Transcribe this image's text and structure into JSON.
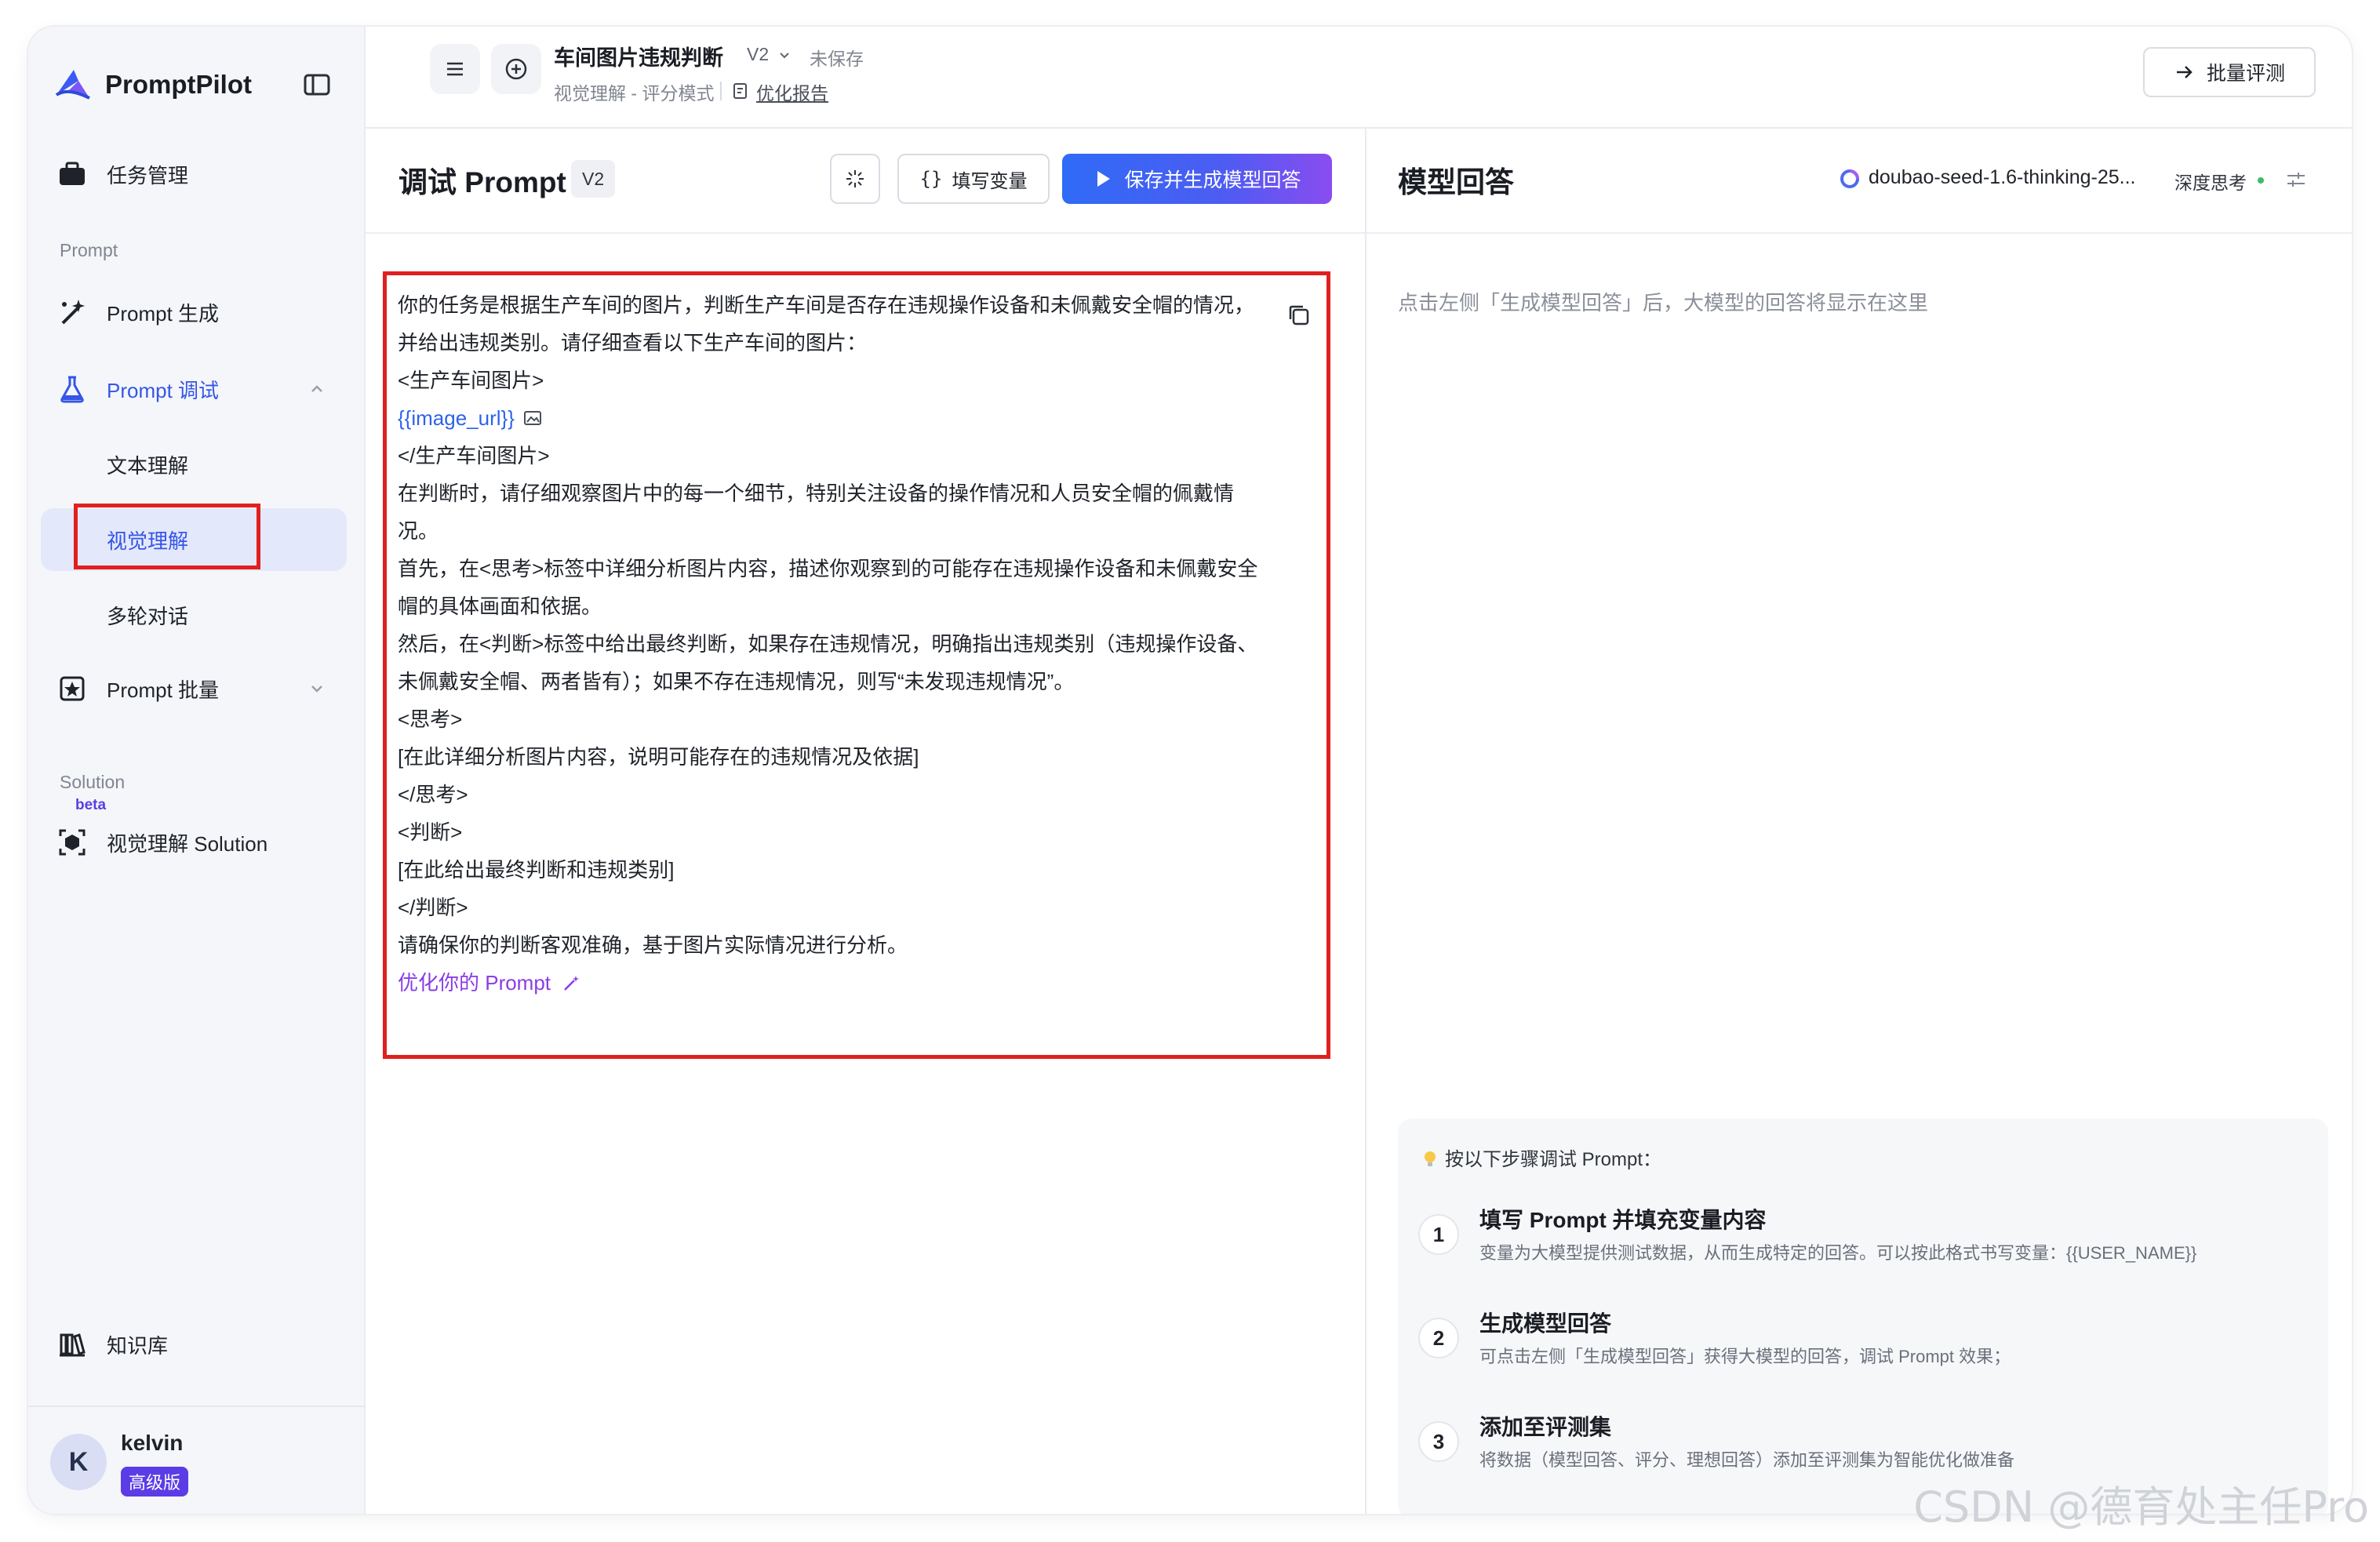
{
  "brand": {
    "name": "PromptPilot"
  },
  "sidebar": {
    "task_mgmt": "任务管理",
    "section_prompt": "Prompt",
    "prompt_gen": "Prompt 生成",
    "prompt_debug": "Prompt 调试",
    "sub_text": "文本理解",
    "sub_vision": "视觉理解",
    "sub_multi": "多轮对话",
    "prompt_batch": "Prompt 批量",
    "section_solution": "Solution",
    "beta": "beta",
    "vision_solution": "视觉理解 Solution",
    "knowledge": "知识库"
  },
  "user": {
    "initial": "K",
    "name": "kelvin",
    "plan": "高级版"
  },
  "topbar": {
    "title": "车间图片违规判断",
    "version": "V2",
    "status": "未保存",
    "mode": "视觉理解 - 评分模式",
    "report": "优化报告",
    "batch_eval": "批量评测"
  },
  "prompt_panel": {
    "title": "调试 Prompt",
    "version": "V2",
    "fill_vars": "填写变量",
    "save_generate": "保存并生成模型回答",
    "lines": [
      "你的任务是根据生产车间的图片，判断生产车间是否存在违规操作设备和未佩戴安全帽的情况，",
      "并给出违规类别。请仔细查看以下生产车间的图片：",
      "<生产车间图片>",
      "{{image_url}}",
      "</生产车间图片>",
      "在判断时，请仔细观察图片中的每一个细节，特别关注设备的操作情况和人员安全帽的佩戴情",
      "况。",
      "首先，在<思考>标签中详细分析图片内容，描述你观察到的可能存在违规操作设备和未佩戴安全",
      "帽的具体画面和依据。",
      "然后，在<判断>标签中给出最终判断，如果存在违规情况，明确指出违规类别（违规操作设备、",
      "未佩戴安全帽、两者皆有）；如果不存在违规情况，则写“未发现违规情况”。",
      "<思考>",
      "[在此详细分析图片内容，说明可能存在的违规情况及依据]",
      "</思考>",
      "<判断>",
      "[在此给出最终判断和违规类别]",
      "</判断>",
      "请确保你的判断客观准确，基于图片实际情况进行分析。"
    ],
    "optimize": "优化你的 Prompt"
  },
  "response_panel": {
    "title": "模型回答",
    "model": "doubao-seed-1.6-thinking-25...",
    "deep_think": "深度思考",
    "hint": "点击左侧「生成模型回答」后，大模型的回答将显示在这里",
    "steps_head": "按以下步骤调试 Prompt：",
    "steps": [
      {
        "num": "1",
        "title": "填写 Prompt 并填充变量内容",
        "desc": "变量为大模型提供测试数据，从而生成特定的回答。可以按此格式书写变量：{{USER_NAME}}"
      },
      {
        "num": "2",
        "title": "生成模型回答",
        "desc": "可点击左侧「生成模型回答」获得大模型的回答，调试 Prompt 效果；"
      },
      {
        "num": "3",
        "title": "添加至评测集",
        "desc": "将数据（模型回答、评分、理想回答）添加至评测集为智能优化做准备"
      }
    ]
  },
  "watermark": "CSDN @德育处主任Pro",
  "colors": {
    "accent": "#2f6bf6",
    "purple": "#5b3ce6",
    "highlight_box": "#e02020"
  }
}
